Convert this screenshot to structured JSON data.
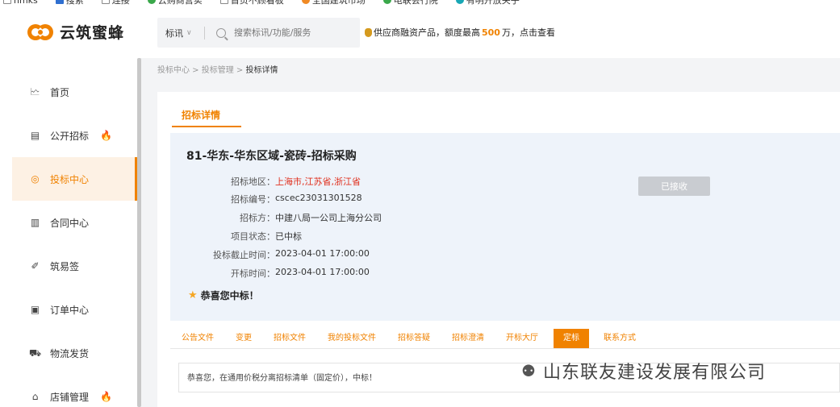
{
  "bookmarks": [
    {
      "label": "hmks",
      "icon": "page-icon"
    },
    {
      "label": "搜索",
      "icon": "person-icon"
    },
    {
      "label": "连接",
      "icon": "page-icon"
    },
    {
      "label": "云购商营实",
      "icon": "globe-icon"
    },
    {
      "label": "首页不顾看板",
      "icon": "page-icon"
    },
    {
      "label": "全国建筑市场",
      "icon": "leaf-icon"
    },
    {
      "label": "电联会行院",
      "icon": "tree-icon"
    },
    {
      "label": "有明开放关子",
      "icon": "circle-icon"
    }
  ],
  "header": {
    "logo_text": "云筑蜜蜂",
    "search_category": "标讯",
    "search_placeholder": "搜索标讯/功能/服务",
    "promo_prefix": "供应商融资产品，额度最高",
    "promo_amount": "500",
    "promo_suffix": "万，点击查看"
  },
  "sidebar": {
    "items": [
      {
        "label": "首页",
        "icon": "chart-icon"
      },
      {
        "label": "公开招标",
        "icon": "briefcase-icon"
      },
      {
        "label": "投标中心",
        "icon": "target-icon"
      },
      {
        "label": "合同中心",
        "icon": "document-icon"
      },
      {
        "label": "筑易签",
        "icon": "pen-icon"
      },
      {
        "label": "订单中心",
        "icon": "order-icon"
      },
      {
        "label": "物流发货",
        "icon": "truck-icon"
      },
      {
        "label": "店铺管理",
        "icon": "shop-icon"
      }
    ]
  },
  "breadcrumb": {
    "part1": "投标中心",
    "sep1": " > ",
    "part2": "投标管理",
    "sep2": " > ",
    "current": "投标详情"
  },
  "main": {
    "tab_label": "招标详情",
    "project_title": "81-华东-华东区域-瓷砖-招标采购",
    "fields": [
      {
        "label": "招标地区：",
        "value": "上海市,江苏省,浙江省"
      },
      {
        "label": "招标编号：",
        "value": "cscec23031301528"
      },
      {
        "label": "招标方：",
        "value": "中建八局一公司上海分公司"
      },
      {
        "label": "项目状态：",
        "value": "已中标"
      },
      {
        "label": "投标截止时间：",
        "value": "2023-04-01 17:00:00"
      },
      {
        "label": "开标时间：",
        "value": "2023-04-01 17:00:00"
      }
    ],
    "status_button": "已接收",
    "congrats": "恭喜您中标！",
    "tabs": [
      "公告文件",
      "变更",
      "招标文件",
      "我的投标文件",
      "招标答疑",
      "招标澄清",
      "开标大厅",
      "定标",
      "联系方式"
    ],
    "active_tab": "定标",
    "result_text": "恭喜您，在通用价税分离招标清单（固定价），中标！"
  },
  "watermark": "山东联友建设发展有限公司",
  "colors": {
    "accent": "#f08200",
    "highlight_red": "#e0301e",
    "panel_bg": "#eef3fa"
  }
}
